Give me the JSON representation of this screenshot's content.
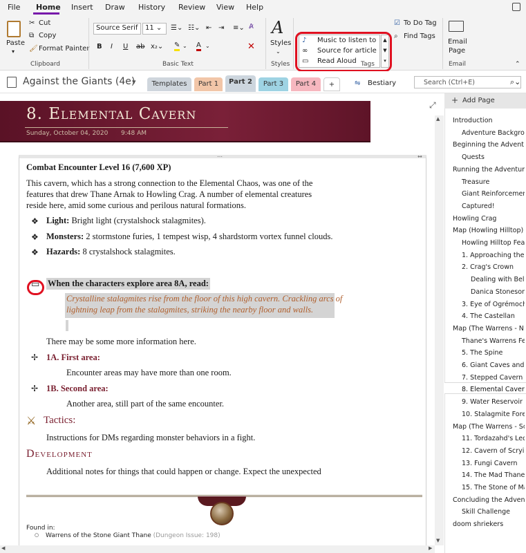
{
  "menu": {
    "items": [
      "File",
      "Home",
      "Insert",
      "Draw",
      "History",
      "Review",
      "View",
      "Help"
    ]
  },
  "ribbon": {
    "clipboard": {
      "paste": "Paste",
      "cut": "Cut",
      "copy": "Copy",
      "format_painter": "Format Painter",
      "label": "Clipboard"
    },
    "basic_text": {
      "font": "Source Serif I",
      "size": "11",
      "label": "Basic Text"
    },
    "styles": {
      "button": "Styles",
      "label": "Styles"
    },
    "tags": {
      "items": [
        "Music to listen to",
        "Source for article",
        "Read Aloud"
      ],
      "todo": "To Do Tag",
      "find": "Find Tags",
      "label": "Tags"
    },
    "email": {
      "line1": "Email",
      "line2": "Page",
      "label": "Email"
    }
  },
  "notebook": {
    "name": "Against the Giants (4e)",
    "tabs": [
      "Templates",
      "Part 1",
      "Part 2",
      "Part 3",
      "Part 4",
      "+"
    ],
    "bestiary": "Bestiary",
    "search_placeholder": "Search (Ctrl+E)"
  },
  "tab_colors": {
    "Templates": "#cfd6dd",
    "Part 1": "#f2c6a8",
    "Part 2": "#cdd6de",
    "Part 3": "#9ed3e3",
    "Part 4": "#f6b7bf"
  },
  "page": {
    "title": "8. Elemental Cavern",
    "date": "Sunday, October 04, 2020",
    "time": "9:48 AM",
    "encounter": "Combat Encounter Level 16 (7,600 XP)",
    "intro": [
      "This cavern, which has a strong connection to the Elemental Chaos, was one of the",
      "features that drew Thane Arnak to Howling Crag. A number of elemental creatures",
      "reside here, amid some curious and perilous natural formations."
    ],
    "bullets": [
      {
        "label": "Light:",
        "text": " Bright light (crystalshock stalagmites)."
      },
      {
        "label": "Monsters:",
        "text": " 2 stormstone furies, 1 tempest wisp, 4 shardstorm vortex funnel clouds."
      },
      {
        "label": "Hazards:",
        "text": " 8 crystalshock stalagmites."
      }
    ],
    "read_heading": "When the characters explore area 8A, read:",
    "read_text": [
      "Crystalline stalagmites rise from the floor of this high cavern. Crackling arcs of",
      "lightning leap from the stalagmites, striking the nearby floor and walls."
    ],
    "more_info": "There may be some more information here.",
    "area1_title": "1A. First area:",
    "area1_text": "Encounter areas may have more than one room.",
    "area2_title": "1B. Second area:",
    "area2_text": "Another area, still part of the same encounter.",
    "tactics_title": "Tactics:",
    "tactics_text": "Instructions for DMs regarding monster behaviors in a fight.",
    "development_title": "Development",
    "development_text": "Additional notes for things that could happen or change. Expect the unexpected",
    "found_in": "Found in:",
    "found_item": "Warrens of the Stone Giant Thane",
    "found_issue": "(Dungeon Issue: 198)"
  },
  "pages_panel": {
    "add": "Add Page",
    "items": [
      "Introduction",
      "Adventure Backgro",
      "Beginning the Advent",
      "Quests",
      "Running the Adventur",
      "Treasure",
      "Giant Reinforcemen",
      "Captured!",
      "Howling Crag",
      "Map (Howling Hilltop)",
      "Howling Hilltop Fea",
      "1. Approaching the",
      "2. Crag's Crown",
      "Dealing with Bel",
      "Danica Stoneson",
      "3. Eye of Ogrémoch",
      "4. The Castellan",
      "Map (The Warrens - N",
      "Thane's Warrens Fe",
      "5. The Spine",
      "6. Giant Caves and",
      "7. Stepped Cavern",
      "8. Elemental Cavern",
      "9. Water Reservoir",
      "10. Stalagmite Fores",
      "Map (The Warrens - So",
      "11. Tordazahd's Led",
      "12. Cavern of Scryin",
      "13. Fungi Cavern",
      "14. The Mad Thane",
      "15. The Stone of Ma",
      "Concluding the Adven",
      "Skill Challenge",
      "doom shriekers"
    ],
    "selected": "8. Elemental Cavern"
  }
}
